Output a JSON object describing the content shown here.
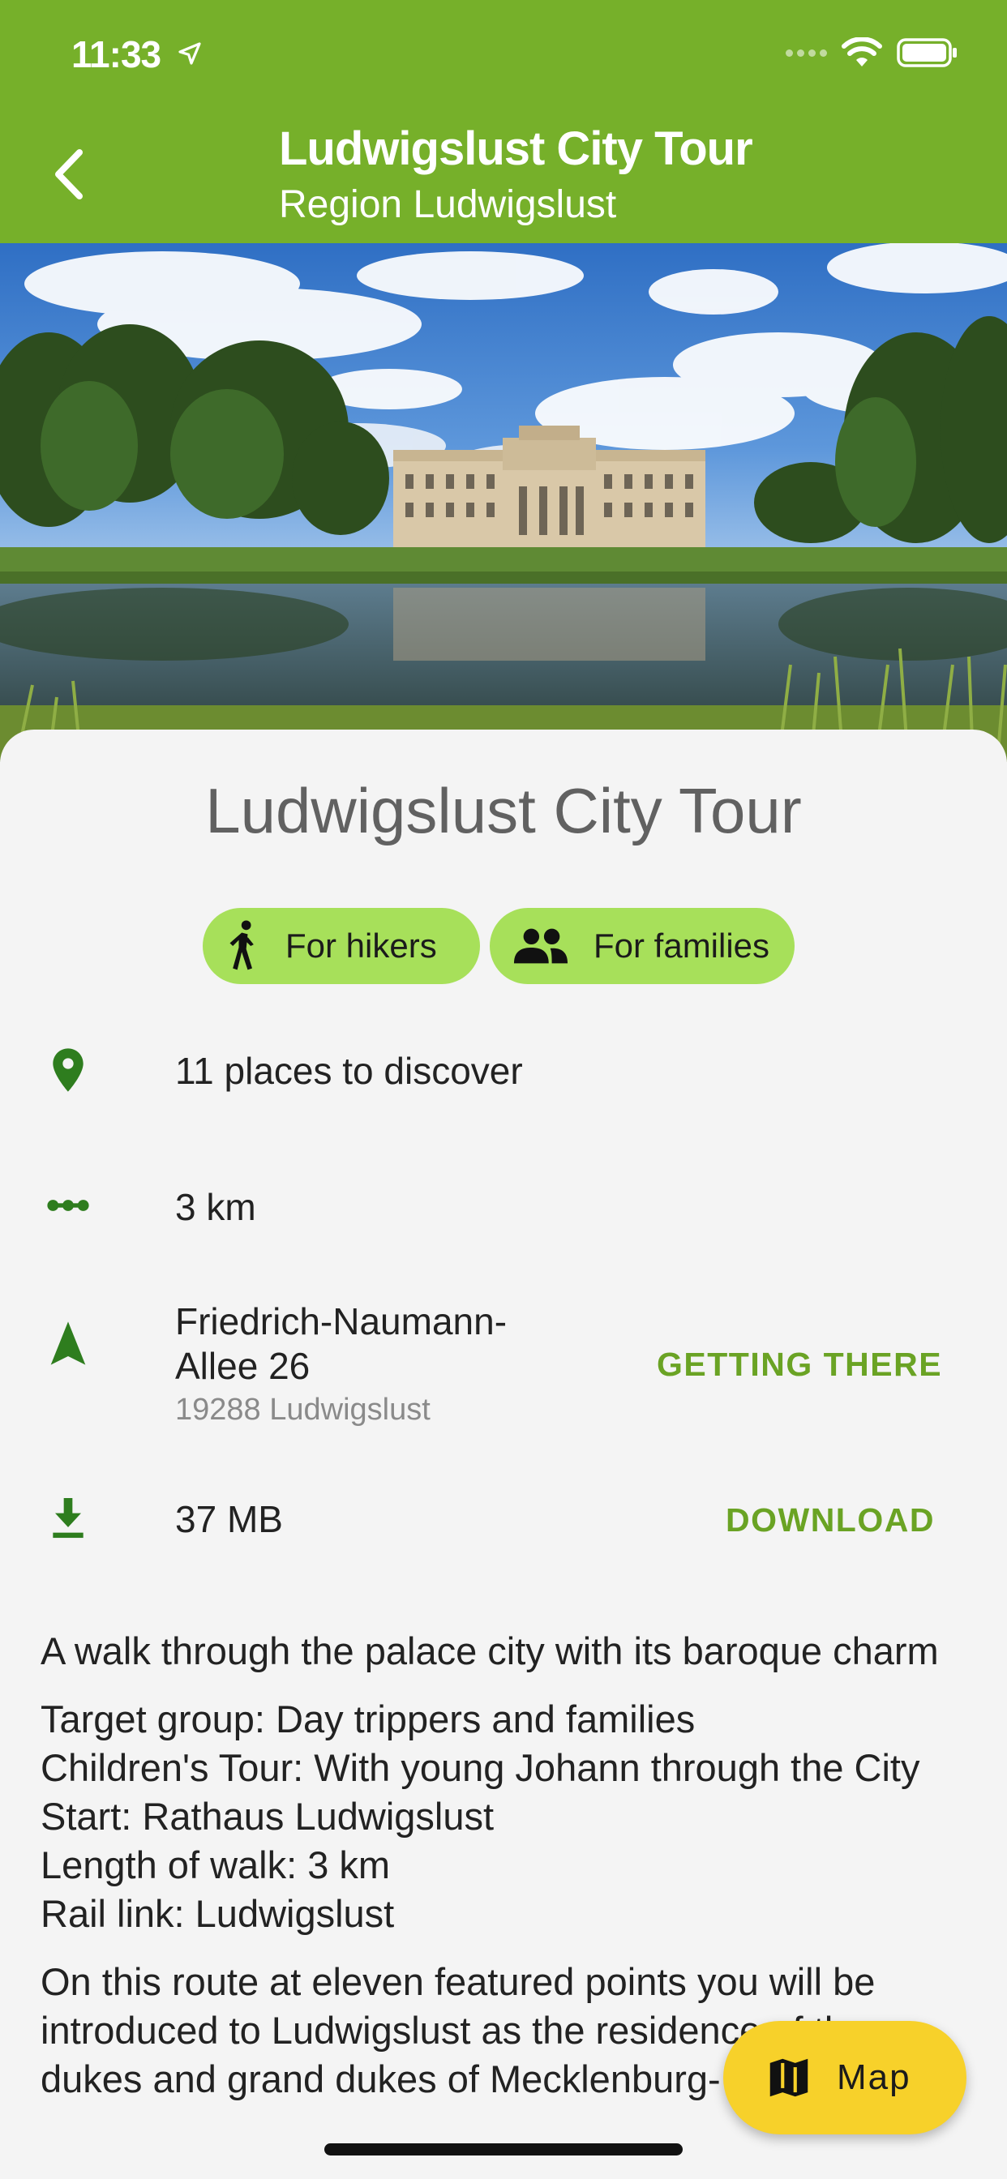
{
  "status_bar": {
    "time": "11:33"
  },
  "header": {
    "title": "Ludwigslust City Tour",
    "subtitle": "Region Ludwigslust"
  },
  "tour": {
    "title": "Ludwigslust City Tour",
    "tags": [
      {
        "label": "For hikers",
        "icon": "hiker-icon"
      },
      {
        "label": "For families",
        "icon": "people-icon"
      }
    ],
    "places": "11 places to discover",
    "distance": "3 km",
    "address_line1": "Friedrich-Naumann-",
    "address_line2": "Allee  26",
    "address_city": "19288 Ludwigslust",
    "getting_there_label": "GETTING THERE",
    "size": "37 MB",
    "download_label": "DOWNLOAD"
  },
  "description": {
    "intro": "A walk through the palace city with its baroque charm",
    "details": [
      "Target group: Day trippers and families",
      "Children's Tour: With young Johann through the City",
      "Start: Rathaus Ludwigslust",
      "Length of walk: 3 km",
      "Rail link: Ludwigslust"
    ],
    "more": "On this route at eleven featured points you will be introduced to Ludwigslust as the residence of the dukes and grand dukes of Mecklenburg-"
  },
  "fab": {
    "label": "Map",
    "icon": "map-icon"
  },
  "colors": {
    "header": "#76b02a",
    "chip": "#a7e05a",
    "accent": "#6aa324",
    "fab": "#f7d12a"
  }
}
